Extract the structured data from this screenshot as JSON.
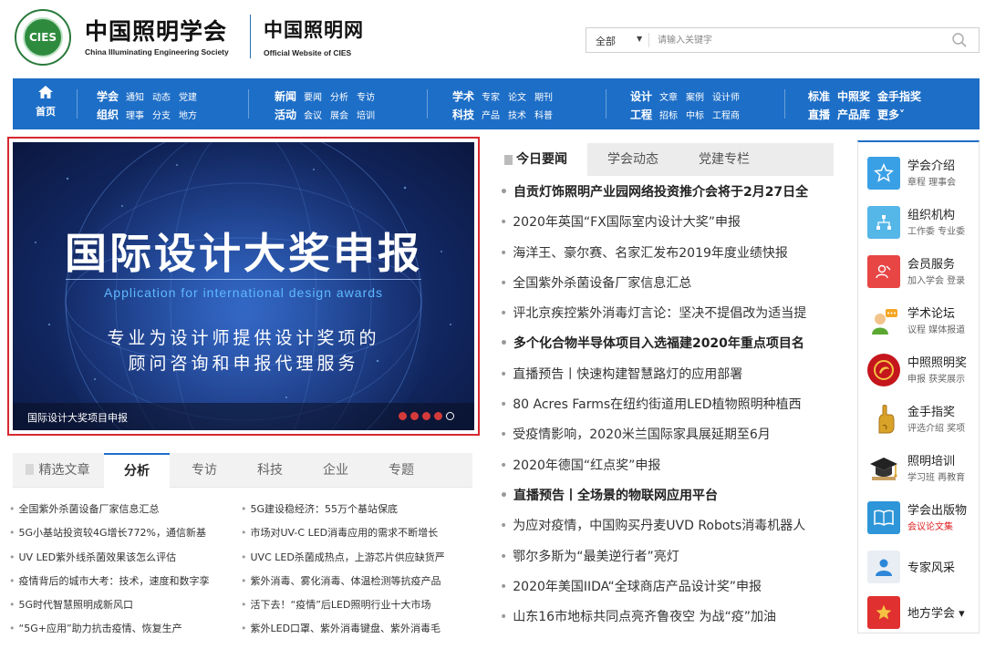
{
  "header": {
    "logo_text": "CIES",
    "site_name_cn": "中国照明学会",
    "site_name_en": "China Illuminating Engineering Society",
    "site2_name_cn": "中国照明网",
    "site2_name_en": "Official Website of CIES",
    "search": {
      "scope": "全部",
      "placeholder": "请输入关键字"
    }
  },
  "nav": {
    "home_label": "首页",
    "groups": [
      {
        "rows": [
          {
            "lead": "学会",
            "items": [
              "通知",
              "动态",
              "党建"
            ]
          },
          {
            "lead": "组织",
            "items": [
              "理事",
              "分支",
              "地方"
            ]
          }
        ]
      },
      {
        "rows": [
          {
            "lead": "新闻",
            "items": [
              "要闻",
              "分析",
              "专访"
            ]
          },
          {
            "lead": "活动",
            "items": [
              "会议",
              "展会",
              "培训"
            ]
          }
        ]
      },
      {
        "rows": [
          {
            "lead": "学术",
            "items": [
              "专家",
              "论文",
              "期刊"
            ]
          },
          {
            "lead": "科技",
            "items": [
              "产品",
              "技术",
              "科普"
            ]
          }
        ]
      },
      {
        "rows": [
          {
            "lead": "设计",
            "items": [
              "文章",
              "案例",
              "设计师"
            ]
          },
          {
            "lead": "工程",
            "items": [
              "招标",
              "中标",
              "工程商"
            ]
          }
        ]
      },
      {
        "rows": [
          {
            "lead": "标准",
            "items": [
              "中照奖",
              "金手指奖"
            ]
          },
          {
            "lead": "直播",
            "items": [
              "产品库",
              "更多˅"
            ]
          }
        ]
      }
    ]
  },
  "banner": {
    "title": "国际设计大奖申报",
    "subtitle_en": "Application for international design awards",
    "line1": "专业为设计师提供设计奖项的",
    "line2": "顾问咨询和申报代理服务",
    "caption": "国际设计大奖项目申报",
    "slide_count": 5,
    "active_slide": 5
  },
  "featured": {
    "tabs": [
      "精选文章",
      "分析",
      "专访",
      "科技",
      "企业",
      "专题"
    ],
    "active_tab": "分析",
    "left_items": [
      "全国紫外杀菌设备厂家信息汇总",
      "5G小基站投资较4G增长772%，通信新基",
      "UV LED紫外线杀菌效果该怎么评估",
      "疫情背后的城市大考：技术，速度和数字孪",
      "5G时代智慧照明成新风口",
      "“5G+应用”助力抗击疫情、恢复生产"
    ],
    "right_items": [
      "5G建设稳经济：55万个基站保底",
      "市场对UV-C LED消毒应用的需求不断增长",
      "UVC LED杀菌成热点，上游芯片供应缺货严",
      "紫外消毒、雾化消毒、体温检测等抗疫产品",
      "活下去！“疫情”后LED照明行业十大市场",
      "紫外LED口罩、紫外消毒键盘、紫外消毒毛"
    ]
  },
  "news": {
    "tabs": [
      "今日要闻",
      "学会动态",
      "党建专栏"
    ],
    "active_tab": "今日要闻",
    "items": [
      {
        "text": "自贡灯饰照明产业园网络投资推介会将于2月27日全",
        "bold": true
      },
      {
        "text": "2020年英国“FX国际室内设计大奖”申报",
        "bold": false
      },
      {
        "text": "海洋王、豪尔赛、名家汇发布2019年度业绩快报",
        "bold": false
      },
      {
        "text": "全国紫外杀菌设备厂家信息汇总",
        "bold": false
      },
      {
        "text": "评北京疾控紫外消毒灯言论：坚决不提倡改为适当提",
        "bold": false
      },
      {
        "text": "多个化合物半导体项目入选福建2020年重点项目名",
        "bold": true
      },
      {
        "text": "直播预告丨快速构建智慧路灯的应用部署",
        "bold": false
      },
      {
        "text": "80 Acres Farms在纽约街道用LED植物照明种植西",
        "bold": false
      },
      {
        "text": "受疫情影响，2020米兰国际家具展延期至6月",
        "bold": false
      },
      {
        "text": "2020年德国“红点奖”申报",
        "bold": false
      },
      {
        "text": "直播预告丨全场景的物联网应用平台",
        "bold": true
      },
      {
        "text": "为应对疫情，中国购买丹麦UVD Robots消毒机器人",
        "bold": false
      },
      {
        "text": "鄂尔多斯为“最美逆行者”亮灯",
        "bold": false
      },
      {
        "text": "2020年美国IIDA“全球商店产品设计奖”申报",
        "bold": false
      },
      {
        "text": "山东16市地标共同点亮齐鲁夜空 为战“疫”加油",
        "bold": false
      }
    ]
  },
  "sidebar": {
    "items": [
      {
        "title": "学会介绍",
        "sub": "章程 理事会",
        "icon": "star-icon",
        "color": "#3aa0e6"
      },
      {
        "title": "组织机构",
        "sub": "工作委 专业委",
        "icon": "org-chart-icon",
        "color": "#55b6e8"
      },
      {
        "title": "会员服务",
        "sub": "加入学会 登录",
        "icon": "member-icon",
        "color": "#e84545"
      },
      {
        "title": "学术论坛",
        "sub": "议程 媒体报道",
        "icon": "speaker-icon",
        "color": "#ffffff"
      },
      {
        "title": "中照照明奖",
        "sub": "申报 获奖展示",
        "icon": "award-logo-icon",
        "color": "#c4161c"
      },
      {
        "title": "金手指奖",
        "sub": "评选介绍 奖项",
        "icon": "golden-finger-icon",
        "color": "#ffffff"
      },
      {
        "title": "照明培训",
        "sub": "学习班 再教育",
        "icon": "graduation-cap-icon",
        "color": "#ffffff"
      },
      {
        "title": "学会出版物",
        "sub": "会议论文集",
        "icon": "book-icon",
        "color": "#2e96d8"
      },
      {
        "title": "专家风采",
        "sub": "",
        "icon": "expert-icon",
        "color": "#e9eef4"
      },
      {
        "title": "地方学会 ▾",
        "sub": "",
        "icon": "star-red-icon",
        "color": "#e03030"
      }
    ]
  }
}
